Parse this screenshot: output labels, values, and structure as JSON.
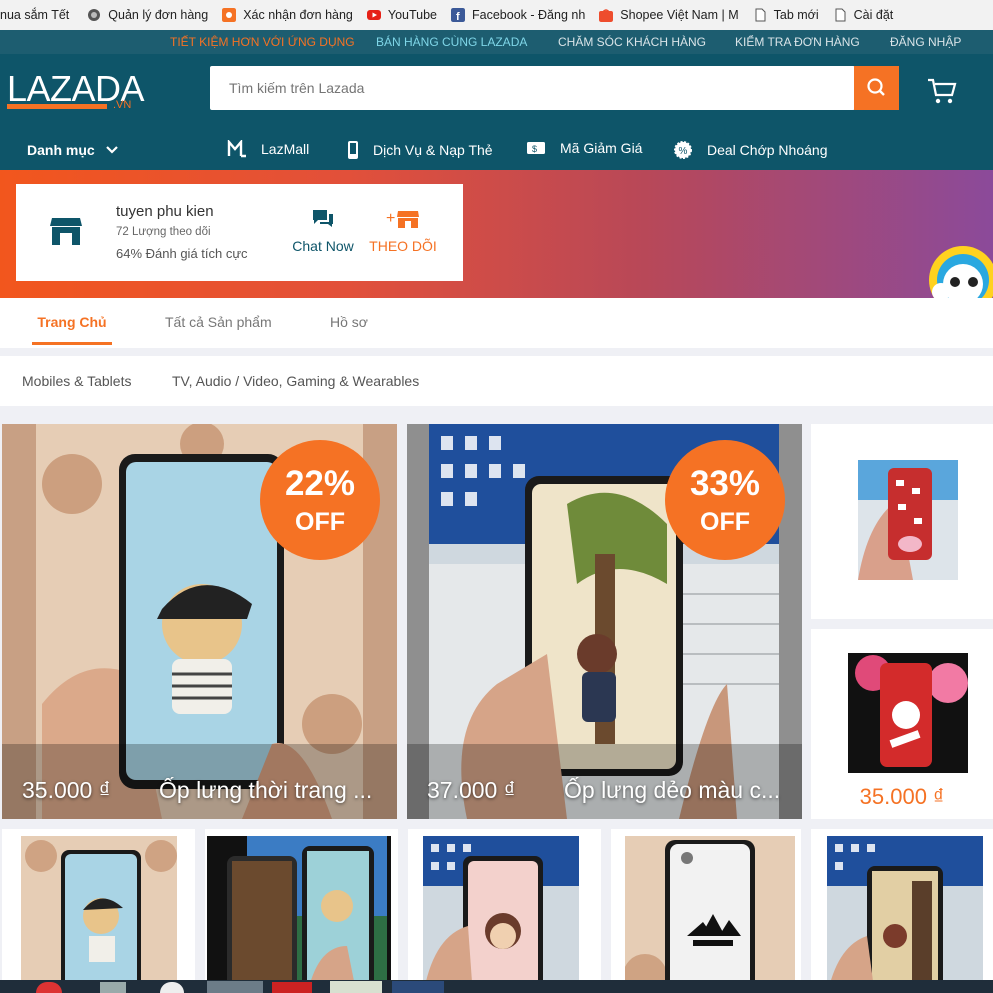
{
  "bookmarks": [
    {
      "label": "nua sắm Tết",
      "icon": "none",
      "color": ""
    },
    {
      "label": "Quản lý đơn hàng",
      "icon": "globe-icon",
      "color": "#6b6b6b"
    },
    {
      "label": "Xác nhận đơn hàng",
      "icon": "app-icon",
      "color": "#f57224"
    },
    {
      "label": "YouTube",
      "icon": "youtube-icon",
      "color": "#e62117"
    },
    {
      "label": "Facebook - Đăng nh",
      "icon": "facebook-icon",
      "color": "#3b5998"
    },
    {
      "label": "Shopee Việt Nam | M",
      "icon": "shopee-icon",
      "color": "#ee4d2d"
    },
    {
      "label": "Tab mới",
      "icon": "page-icon",
      "color": "#666666"
    },
    {
      "label": "Cài đặt",
      "icon": "page-icon",
      "color": "#666666"
    }
  ],
  "toplinks": {
    "app": "TIẾT KIỆM HƠN VỚI ỨNG DỤNG",
    "sell": "BÁN HÀNG CÙNG LAZADA",
    "care": "CHĂM SÓC KHÁCH HÀNG",
    "track": "KIỂM TRA ĐƠN HÀNG",
    "login": "ĐĂNG NHẬP"
  },
  "header": {
    "logo_text": "LAZADA",
    "logo_suffix": ".VN",
    "search_placeholder": "Tìm kiếm trên Lazada",
    "category_label": "Danh mục",
    "nav": [
      "LazMall",
      "Dịch Vụ & Nạp Thẻ",
      "Mã Giảm Giá",
      "Deal Chớp Nhoáng"
    ]
  },
  "shop": {
    "name": "tuyen phu kien",
    "followers": "72 Lượng theo dõi",
    "rating": "64% Đánh giá tích cực",
    "chat_label": "Chat Now",
    "follow_label": "THEO DÕI"
  },
  "tabs": [
    "Trang Chủ",
    "Tất cả Sản phẩm",
    "Hồ sơ"
  ],
  "categories": [
    "Mobiles & Tablets",
    "TV, Audio / Video, Gaming & Wearables"
  ],
  "featured": [
    {
      "price": "35.000 ₫",
      "name": "Ốp lưng thời trang ...",
      "discount": "22%",
      "off": "OFF"
    },
    {
      "price": "37.000 ₫",
      "name": "Ốp lưng dẻo màu c...",
      "discount": "33%",
      "off": "OFF"
    }
  ],
  "side_price": "35.000 ₫",
  "colors": {
    "accent": "#f57224",
    "header": "#0e5569",
    "toplinks": "#1d5d70",
    "active_tab": "#f57224",
    "sell_link": "#7fd6e8"
  }
}
